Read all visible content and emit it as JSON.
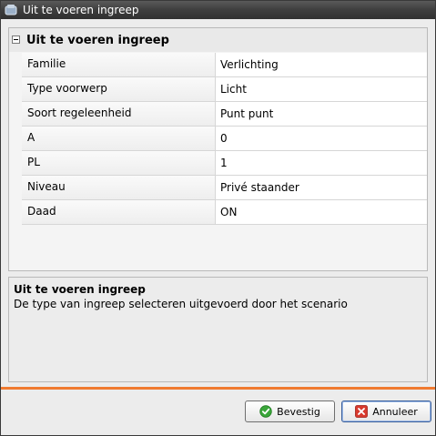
{
  "window": {
    "title": "Uit te voeren ingreep"
  },
  "grid": {
    "group_title": "Uit te voeren ingreep",
    "rows": [
      {
        "name": "Familie",
        "value": "Verlichting"
      },
      {
        "name": "Type voorwerp",
        "value": "Licht"
      },
      {
        "name": "Soort regeleenheid",
        "value": "Punt punt"
      },
      {
        "name": "A",
        "value": "0"
      },
      {
        "name": "PL",
        "value": "1"
      },
      {
        "name": "Niveau",
        "value": "Privé staander"
      },
      {
        "name": "Daad",
        "value": "ON"
      }
    ]
  },
  "description": {
    "title": "Uit te voeren ingreep",
    "text": "De type van ingreep selecteren uitgevoerd door het scenario"
  },
  "buttons": {
    "confirm": "Bevestig",
    "cancel": "Annuleer"
  },
  "colors": {
    "accent_line": "#f07a30",
    "confirm_icon": "#3aa63a",
    "cancel_icon": "#d83a2e"
  }
}
